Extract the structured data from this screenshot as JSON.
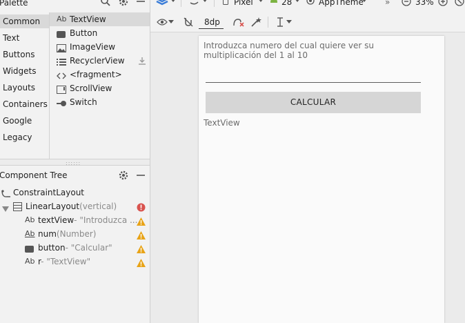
{
  "palette": {
    "title": "Palette",
    "categories": [
      "Common",
      "Text",
      "Buttons",
      "Widgets",
      "Layouts",
      "Containers",
      "Google",
      "Legacy"
    ],
    "selected_category": "Common",
    "items": [
      {
        "label": "TextView",
        "icon": "textview-icon",
        "prefix": "Ab"
      },
      {
        "label": "Button",
        "icon": "button-icon"
      },
      {
        "label": "ImageView",
        "icon": "image-icon"
      },
      {
        "label": "RecyclerView",
        "icon": "list-icon"
      },
      {
        "label": "<fragment>",
        "icon": "code-icon"
      },
      {
        "label": "ScrollView",
        "icon": "scrollview-icon"
      },
      {
        "label": "Switch",
        "icon": "switch-icon"
      }
    ]
  },
  "component_tree": {
    "title": "Component Tree",
    "nodes": [
      {
        "name": "ConstraintLayout",
        "suffix": ""
      },
      {
        "name": "LinearLayout",
        "suffix": "(vertical)"
      },
      {
        "name": "textView",
        "suffix": "- \"Introduzca ...",
        "prefix": "Ab"
      },
      {
        "name": "num",
        "suffix": "(Number)",
        "prefix": "Ab"
      },
      {
        "name": "button",
        "suffix": "- \"Calcular\""
      },
      {
        "name": "r",
        "suffix": "- \"TextView\"",
        "prefix": "Ab"
      }
    ]
  },
  "toolbar": {
    "device": "Pixel",
    "api": "28",
    "theme": "AppTheme",
    "overflow": "»",
    "zoom": "33%",
    "margin": "8dp"
  },
  "device": {
    "intro_text": "Introduzca numero del cual quiere ver su multiplicación del 1 al 10",
    "button_label": "CALCULAR",
    "textview_text": "TextView"
  },
  "colors": {
    "error": "#d9534f",
    "warning": "#e8a317",
    "layers_blue": "#3b7dd8",
    "android_green": "#7cb342"
  }
}
